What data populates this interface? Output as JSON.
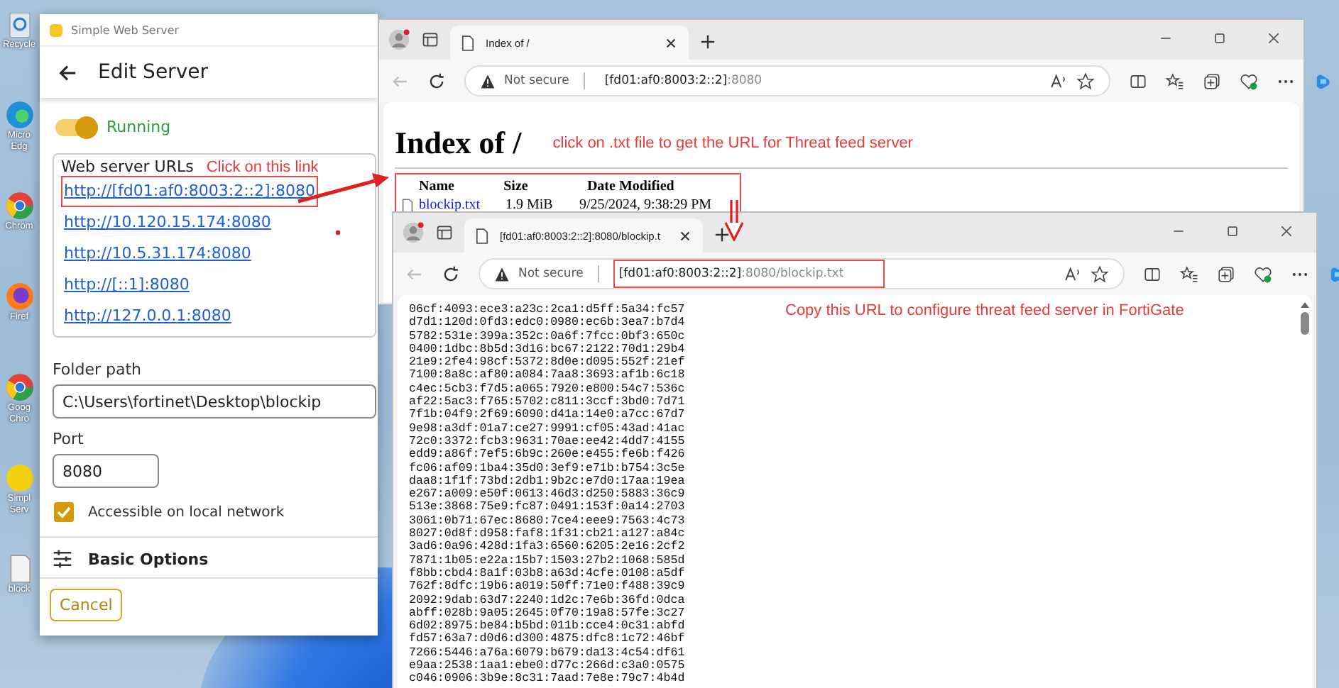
{
  "desktop_icons": [
    {
      "kind": "recycle",
      "label": "Recycle"
    },
    {
      "kind": "edge",
      "label": "Micro Edg"
    },
    {
      "kind": "chrome",
      "label": "Chrom"
    },
    {
      "kind": "firefox",
      "label": "Firef"
    },
    {
      "kind": "chrome",
      "label": "Goog Chro"
    },
    {
      "kind": "server",
      "label": "Simpl Serv"
    },
    {
      "kind": "file",
      "label": "block"
    }
  ],
  "server_window": {
    "title": "Simple Web Server",
    "heading": "Edit Server",
    "running": {
      "on": true,
      "label": "Running"
    },
    "urls_title": "Web server URLs",
    "urls_note": "Click on this link",
    "urls": [
      {
        "text": "http://[fd01:af0:8003:2::2]:8080",
        "highlighted": true
      },
      {
        "text": "http://10.120.15.174:8080",
        "highlighted": false
      },
      {
        "text": "http://10.5.31.174:8080",
        "highlighted": false
      },
      {
        "text": "http://[::1]:8080",
        "highlighted": false
      },
      {
        "text": "http://127.0.0.1:8080",
        "highlighted": false
      }
    ],
    "folder_label": "Folder path",
    "folder_value": "C:\\Users\\fortinet\\Desktop\\blockip",
    "port_label": "Port",
    "port_value": "8080",
    "local_network": {
      "checked": true,
      "label": "Accessible on local network"
    },
    "section": "Basic Options",
    "cancel": "Cancel"
  },
  "browsers": [
    {
      "kind": "directory",
      "tab_title": "Index of /",
      "address": {
        "not_secure": "Not secure",
        "host": "[fd01:af0:8003:2::2]",
        "path": ":8080",
        "highlighted": false
      },
      "heading": "Index of /",
      "note": "click on .txt file to get the URL for Threat feed server",
      "table": {
        "highlighted": true,
        "columns": [
          "Name",
          "Size",
          "Date Modified"
        ],
        "rows": [
          {
            "name": "blockip.txt",
            "size": "1.9 MiB",
            "modified": "9/25/2024, 9:38:29 PM"
          }
        ]
      }
    },
    {
      "kind": "file",
      "tab_title": "[fd01:af0:8003:2::2]:8080/blockip.t",
      "address": {
        "not_secure": "Not secure",
        "host": "[fd01:af0:8003:2::2]",
        "path": ":8080/blockip.txt",
        "highlighted": true
      },
      "note": "Copy this URL to configure threat feed server in FortiGate",
      "lines": [
        "06cf:4093:ece3:a23c:2ca1:d5ff:5a34:fc57",
        "d7d1:120d:0fd3:edc0:0980:ec6b:3ea7:b7d4",
        "5782:531e:399a:352c:0a6f:7fcc:0bf3:650c",
        "0400:1dbc:8b5d:3d16:bc67:2122:70d1:29b4",
        "21e9:2fe4:98cf:5372:8d0e:d095:552f:21ef",
        "7100:8a8c:af80:a084:7aa8:3693:af1b:6c18",
        "c4ec:5cb3:f7d5:a065:7920:e800:54c7:536c",
        "af22:5ac3:f765:5702:c811:3ccf:3bd0:7d71",
        "7f1b:04f9:2f69:6090:d41a:14e0:a7cc:67d7",
        "9e98:a3df:01a7:ce27:9991:cf05:43ad:41ac",
        "72c0:3372:fcb3:9631:70ae:ee42:4dd7:4155",
        "edd9:a86f:7ef5:6b9c:260e:e455:fe6b:f426",
        "fc06:af09:1ba4:35d0:3ef9:e71b:b754:3c5e",
        "daa8:1f1f:73bd:2db1:9b2c:e7d0:17aa:19ea",
        "e267:a009:e50f:0613:46d3:d250:5883:36c9",
        "513e:3868:75e9:fc87:0491:153f:0a14:2703",
        "3061:0b71:67ec:8680:7ce4:eee9:7563:4c73",
        "8027:0d8f:d958:faf8:1f31:cb21:a127:a84c",
        "3ad6:0a96:428d:1fa3:6560:6205:2e16:2cf2",
        "7871:1b05:e22a:15b7:1503:27b2:1068:585d",
        "f8bb:cbd4:8a1f:03b8:a63d:4cfe:0108:a5df",
        "762f:8dfc:19b6:a019:50ff:71e0:f488:39c9",
        "2092:9dab:63d7:2240:1d2c:7e6b:36fd:0dca",
        "abff:028b:9a05:2645:0f70:19a8:57fe:3c27",
        "6d02:8975:be84:b5bd:011b:cce4:0c31:abfd",
        "fd57:63a7:d0d6:d300:4875:dfc8:1c72:46bf",
        "7266:5446:a76a:6079:b679:da13:4c54:df61",
        "e9aa:2538:1aa1:ebe0:d77c:266d:c3a0:0575",
        "c046:0906:3b9e:8c31:7aad:7e8e:79c7:4b4d"
      ]
    }
  ]
}
